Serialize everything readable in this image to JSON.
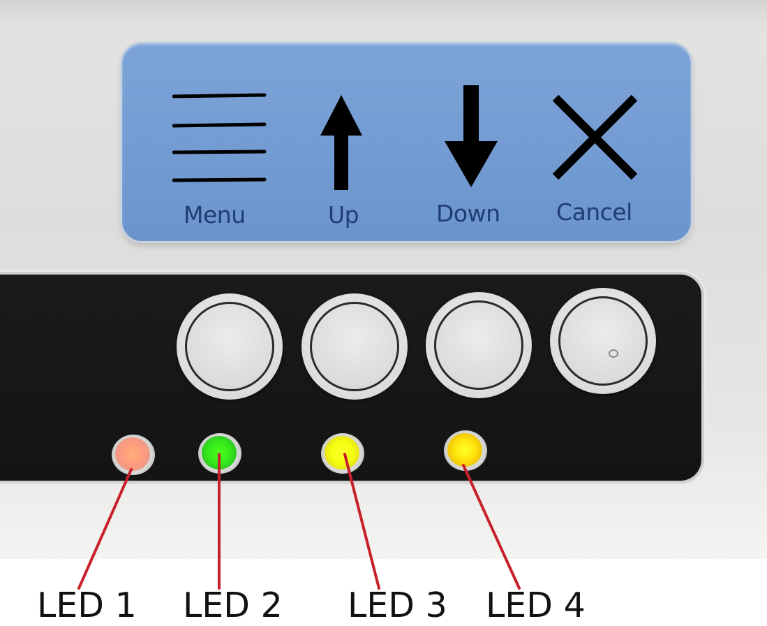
{
  "panel": {
    "buttons": [
      {
        "label": "Menu",
        "icon": "menu-icon"
      },
      {
        "label": "Up",
        "icon": "arrow-up-icon"
      },
      {
        "label": "Down",
        "icon": "arrow-down-icon"
      },
      {
        "label": "Cancel",
        "icon": "close-icon"
      }
    ]
  },
  "leds": [
    {
      "label": "LED 1",
      "color": "#ff9f7e"
    },
    {
      "label": "LED 2",
      "color": "#33e61a"
    },
    {
      "label": "LED 3",
      "color": "#f4ff10"
    },
    {
      "label": "LED 4",
      "color": "#ffe20a"
    }
  ],
  "colors": {
    "label_panel": "#729bd2",
    "label_text": "#1f3d73",
    "callout_line": "#c8202a"
  }
}
